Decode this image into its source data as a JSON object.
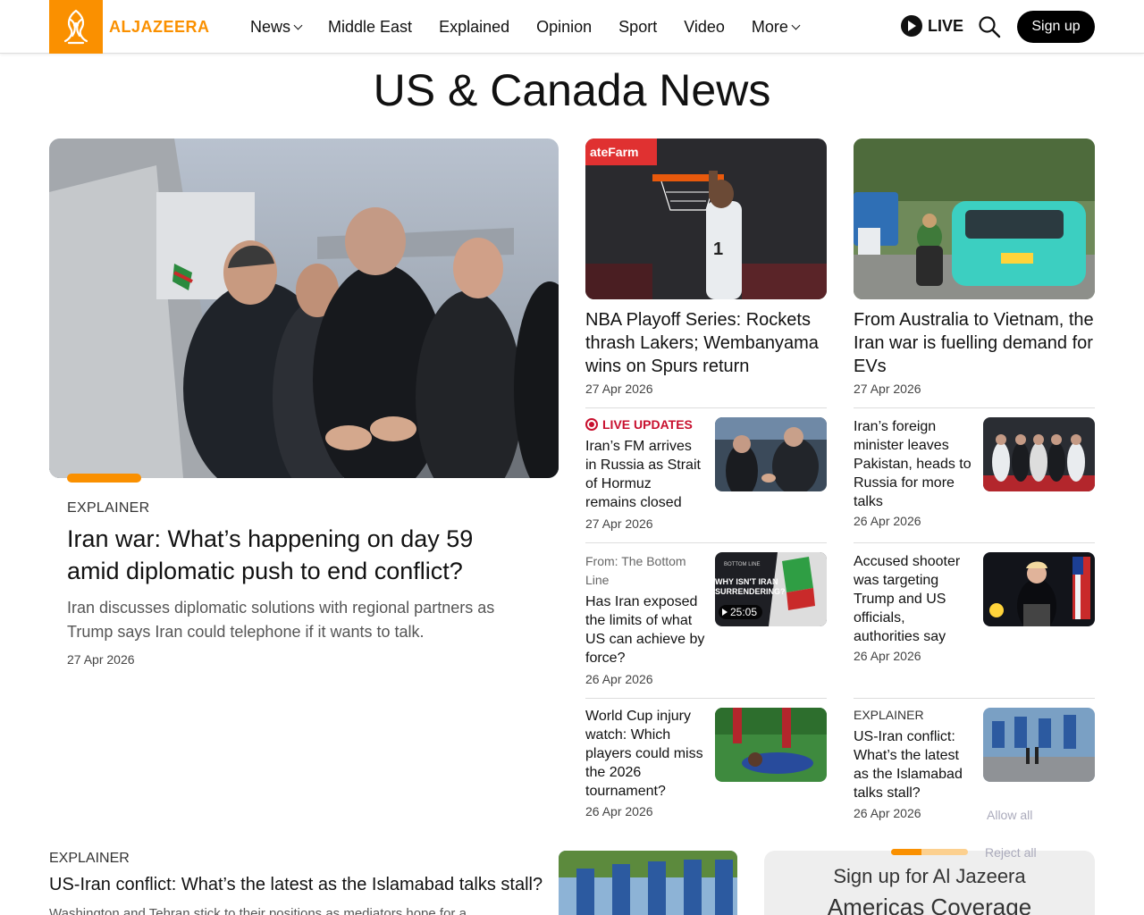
{
  "header": {
    "logo_text": "ALJAZEERA",
    "nav": [
      {
        "label": "News",
        "dropdown": true
      },
      {
        "label": "Middle East",
        "dropdown": false
      },
      {
        "label": "Explained",
        "dropdown": false
      },
      {
        "label": "Opinion",
        "dropdown": false
      },
      {
        "label": "Sport",
        "dropdown": false
      },
      {
        "label": "Video",
        "dropdown": false
      },
      {
        "label": "More",
        "dropdown": true
      }
    ],
    "live_label": "LIVE",
    "signup_label": "Sign up",
    "brand_color": "#fa9000"
  },
  "page_title": "US & Canada News",
  "hero": {
    "label": "EXPLAINER",
    "title": "Iran war: What’s happening on day 59 amid diplomatic push to end conflict?",
    "description": "Iran discusses diplomatic solutions with regional partners as Trump says Iran could telephone if it wants to talk.",
    "date": "27 Apr 2026"
  },
  "cards": [
    {
      "title": "NBA Playoff Series: Rockets thrash Lakers; Wembanyama wins on Spurs return",
      "date": "27 Apr 2026"
    },
    {
      "title": "From Australia to Vietnam, the Iran war is fuelling demand for EVs",
      "date": "27 Apr 2026"
    }
  ],
  "list_left": [
    {
      "tag": "LIVE UPDATES",
      "title": "Iran’s FM arrives in Russia as Strait of Hormuz remains closed",
      "date": "27 Apr 2026"
    },
    {
      "from": "From: The Bottom Line",
      "title": "Has Iran exposed the limits of what US can achieve by force?",
      "date": "26 Apr 2026",
      "duration": "25:05",
      "thumb_text": "WHY ISN'T IRAN SURRENDERING?"
    },
    {
      "title": "World Cup injury watch: Which players could miss the 2026 tournament?",
      "date": "26 Apr 2026"
    }
  ],
  "list_right": [
    {
      "title": "Iran’s foreign minister leaves Pakistan, heads to Russia for more talks",
      "date": "26 Apr 2026"
    },
    {
      "title": "Accused shooter was targeting Trump and US officials, authorities say",
      "date": "26 Apr 2026"
    },
    {
      "label": "EXPLAINER",
      "title": "US-Iran conflict: What’s the latest as the Islamabad talks stall?",
      "date": "26 Apr 2026"
    }
  ],
  "bottom": {
    "label": "EXPLAINER",
    "title": "US-Iran conflict: What’s the latest as the Islamabad talks stall?",
    "description": "Washington and Tehran stick to their positions as mediators hope for a"
  },
  "newsletter": {
    "title": "Sign up for Al Jazeera",
    "subtitle": "Americas Coverage"
  },
  "consent": {
    "allow": "Allow all",
    "reject": "Reject all",
    "progress": 0.4
  }
}
